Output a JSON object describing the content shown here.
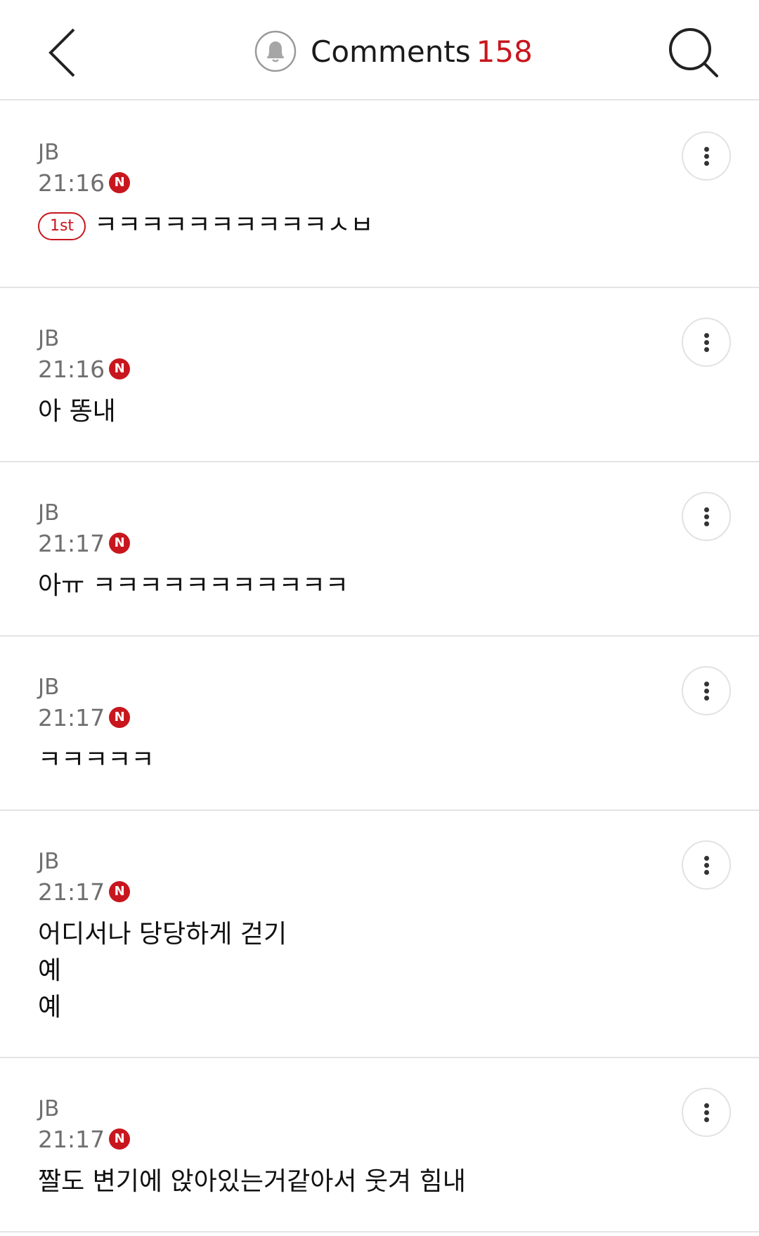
{
  "header": {
    "title": "Comments",
    "count": "158",
    "back_icon": "chevron-left-icon",
    "bell_icon": "bell-icon",
    "search_icon": "search-icon"
  },
  "badges": {
    "new_label": "N",
    "first_label": "1st"
  },
  "colors": {
    "accent": "#c8161e",
    "meta_text": "#6f6f6f",
    "divider": "#e4e4e4"
  },
  "comments": [
    {
      "author": "JB",
      "time": "21:16",
      "lines": [
        "ㅋㅋㅋㅋㅋㅋㅋㅋㅋㅋㅅㅂ"
      ],
      "first": true
    },
    {
      "author": "JB",
      "time": "21:16",
      "lines": [
        "아 똥내"
      ]
    },
    {
      "author": "JB",
      "time": "21:17",
      "lines": [
        "아ㅠ ㅋㅋㅋㅋㅋㅋㅋㅋㅋㅋㅋ"
      ]
    },
    {
      "author": "JB",
      "time": "21:17",
      "lines": [
        "ㅋㅋㅋㅋㅋ"
      ]
    },
    {
      "author": "JB",
      "time": "21:17",
      "lines": [
        "어디서나 당당하게 걷기",
        "예",
        "예"
      ]
    },
    {
      "author": "JB",
      "time": "21:17",
      "lines": [
        "짤도 변기에 앉아있는거같아서 웃겨 힘내"
      ]
    }
  ]
}
